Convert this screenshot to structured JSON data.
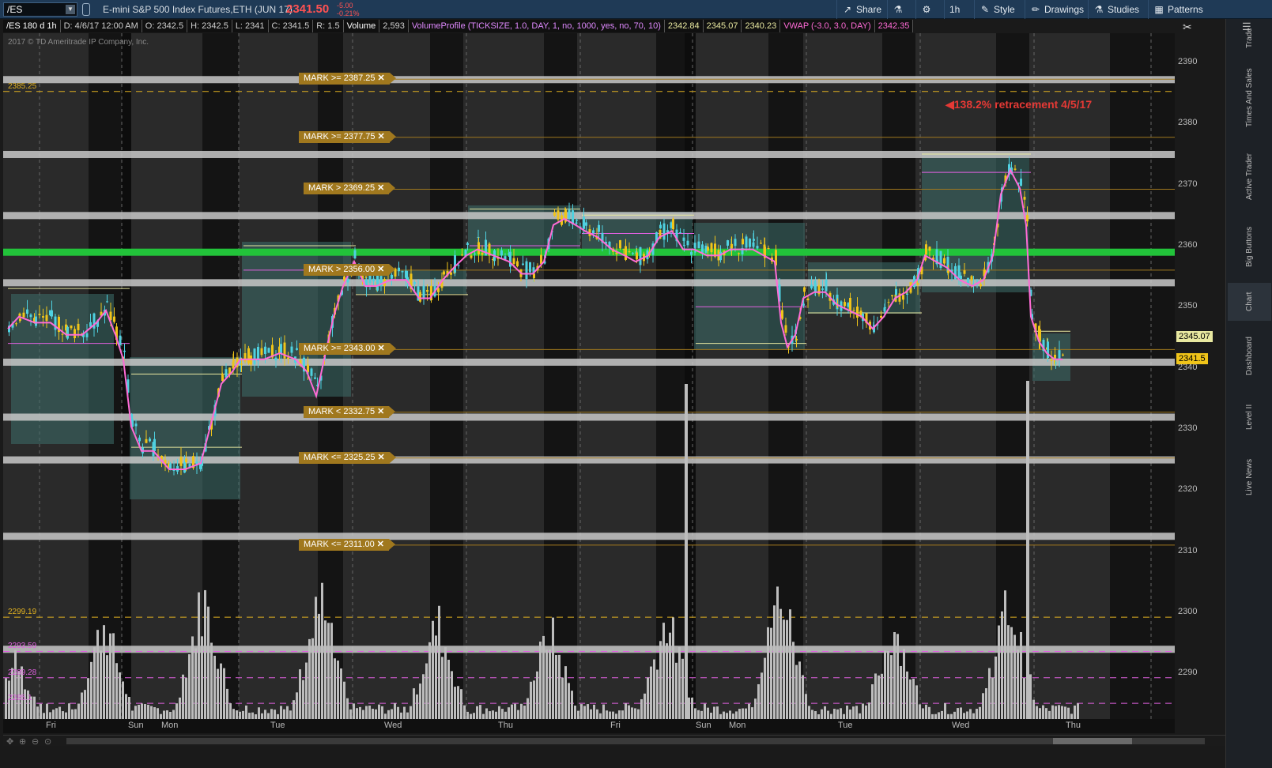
{
  "toolbar": {
    "symbol": "/ES",
    "description": "E-mini S&P 500 Index Futures,ETH (JUN 17)",
    "last_price": "2341.50",
    "change": "-5.00",
    "change_pct": "-0.21%",
    "buttons": [
      {
        "label": "Share",
        "icon": "share-icon",
        "glyph": "↗"
      },
      {
        "label": "",
        "icon": "flask-icon",
        "glyph": "⚗"
      },
      {
        "label": "",
        "icon": "gear-icon",
        "glyph": "⚙"
      },
      {
        "label": "1h",
        "icon": "",
        "glyph": ""
      },
      {
        "label": "Style",
        "icon": "style-icon",
        "glyph": "✎"
      },
      {
        "label": "Drawings",
        "icon": "pencil-icon",
        "glyph": "✏"
      },
      {
        "label": "Studies",
        "icon": "studies-icon",
        "glyph": "⚗"
      },
      {
        "label": "Patterns",
        "icon": "patterns-icon",
        "glyph": "▦"
      }
    ]
  },
  "header": {
    "cells": [
      {
        "text": "/ES 180 d 1h",
        "color": "#ffffff"
      },
      {
        "text": "D: 4/6/17 12:00 AM",
        "color": "#cfcfcf"
      },
      {
        "text": "O: 2342.5",
        "color": "#cfcfcf"
      },
      {
        "text": "H: 2342.5",
        "color": "#cfcfcf"
      },
      {
        "text": "L: 2341",
        "color": "#cfcfcf"
      },
      {
        "text": "C: 2341.5",
        "color": "#cfcfcf"
      },
      {
        "text": "R: 1.5",
        "color": "#cfcfcf"
      },
      {
        "text": "Volume",
        "color": "#ffffff"
      },
      {
        "text": "2,593",
        "color": "#cfcfcf"
      },
      {
        "text": "VolumeProfile (TICKSIZE, 1.0, DAY, 1, no, 1000, yes, no, 70, 10)",
        "color": "#e08aff"
      },
      {
        "text": "2342.84",
        "color": "#e8e8a0"
      },
      {
        "text": "2345.07",
        "color": "#e8e8a0"
      },
      {
        "text": "2340.23",
        "color": "#e8e8a0"
      },
      {
        "text": "VWAP (-3.0, 3.0, DAY)",
        "color": "#ff6bd6"
      },
      {
        "text": "2342.35",
        "color": "#ff6bd6"
      }
    ]
  },
  "copyright": "2017 © TD Ameritrade IP Company, Inc.",
  "annotation": "◀138.2% retracement 4/5/17",
  "marks": [
    {
      "label": "MARK >= 2387.25",
      "price": 2387.25
    },
    {
      "label": "MARK >= 2377.75",
      "price": 2377.75
    },
    {
      "label": "MARK > 2369.25",
      "price": 2369.25
    },
    {
      "label": "MARK > 2356.00",
      "price": 2356.0
    },
    {
      "label": "MARK >= 2343.00",
      "price": 2343.0
    },
    {
      "label": "MARK < 2332.75",
      "price": 2332.75
    },
    {
      "label": "MARK <= 2325.25",
      "price": 2325.25
    },
    {
      "label": "MARK <= 2311.00",
      "price": 2311.0
    }
  ],
  "left_levels": [
    {
      "label": "2385.25",
      "price": 2385.25,
      "color": "#e0b020"
    },
    {
      "label": "2299.19",
      "price": 2299.19,
      "color": "#e0b020"
    },
    {
      "label": "2293.59",
      "price": 2293.59,
      "color": "#e060e0"
    },
    {
      "label": "2289.28",
      "price": 2289.28,
      "color": "#e060e0"
    },
    {
      "label": "2285.1",
      "price": 2285.1,
      "color": "#e060e0"
    }
  ],
  "price_tags": [
    {
      "label": "2345.07",
      "price": 2345.07,
      "color": "#e8e8a0"
    },
    {
      "label": "2341.5",
      "price": 2341.5,
      "color": "#f0c419"
    }
  ],
  "price_axis": [
    "2390",
    "2380",
    "2370",
    "2360",
    "2350",
    "2340",
    "2330",
    "2320",
    "2310",
    "2300",
    "2290"
  ],
  "time_axis": [
    "Fri",
    "Sun",
    "Mon",
    "Tue",
    "Wed",
    "Thu",
    "Fri",
    "Sun",
    "Mon",
    "Tue",
    "Wed",
    "Thu"
  ],
  "right_panel_tabs": [
    "Trade",
    "Times And Sales",
    "Active Trader",
    "Big Buttons",
    "Chart",
    "Dashboard",
    "Level II",
    "Live News"
  ],
  "colors": {
    "up_candle": "#4fd1e0",
    "down_candle": "#f0c419",
    "vwap": "#ff6bd6",
    "support_band": "#ffffff",
    "key_level": "#22c33a",
    "mark_label": "#a0781e",
    "annotation": "#e53935"
  }
}
